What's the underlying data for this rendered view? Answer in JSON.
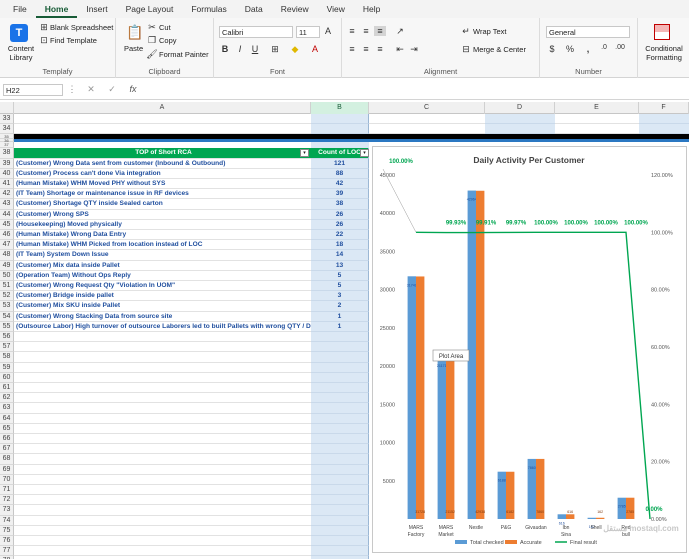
{
  "ribbon_tabs": [
    "File",
    "Home",
    "Insert",
    "Page Layout",
    "Formulas",
    "Data",
    "Review",
    "View",
    "Help"
  ],
  "active_tab": "Home",
  "templafy": {
    "content_library": "Content Library",
    "blank_spreadsheet": "Blank Spreadsheet",
    "find_template": "Find Template",
    "group": "Templafy"
  },
  "clipboard": {
    "paste": "Paste",
    "cut": "Cut",
    "copy": "Copy",
    "format_painter": "Format Painter",
    "group": "Clipboard"
  },
  "font": {
    "name": "Calibri",
    "size": "11",
    "group": "Font"
  },
  "alignment": {
    "wrap": "Wrap Text",
    "merge": "Merge & Center",
    "group": "Alignment"
  },
  "number": {
    "format": "General",
    "group": "Number"
  },
  "styles": {
    "conditional": "Conditional Formatting"
  },
  "name_box": "H22",
  "columns": [
    "A",
    "B",
    "C",
    "D",
    "E",
    "F"
  ],
  "table": {
    "header_a": "TOP of Short RCA",
    "header_b": "Count of LOC",
    "rows": [
      {
        "label": "(Customer) Wrong Data sent from customer (Inbound & Outbound)",
        "count": "121"
      },
      {
        "label": "(Customer) Process can't done Via integration",
        "count": "88"
      },
      {
        "label": "(Human Mistake) WHM Moved PHY without SYS",
        "count": "42"
      },
      {
        "label": "(IT Team) Shortage or maintenance issue in RF devices",
        "count": "39"
      },
      {
        "label": "(Customer) Shortage QTY inside Sealed carton",
        "count": "38"
      },
      {
        "label": "(Customer) Wrong SPS",
        "count": "26"
      },
      {
        "label": "(Housekeeping) Moved physically",
        "count": "26"
      },
      {
        "label": "(Human Mistake) Wrong Data Entry",
        "count": "22"
      },
      {
        "label": "(Human Mistake) WHM Picked from location instead of LOC",
        "count": "18"
      },
      {
        "label": "(IT Team) System Down Issue",
        "count": "14"
      },
      {
        "label": "(Customer) Mix data inside Pallet",
        "count": "13"
      },
      {
        "label": "(Operation Team) Without Ops Reply",
        "count": "5"
      },
      {
        "label": "(Customer) Wrong Request Qty \"Violation In UOM\"",
        "count": "5"
      },
      {
        "label": "(Customer) Bridge inside pallet",
        "count": "3"
      },
      {
        "label": "(Customer) Mix SKU inside Pallet",
        "count": "2"
      },
      {
        "label": "(Customer) Wrong Stacking Data from source site",
        "count": "1"
      },
      {
        "label": "(Outsource Labor) High turnover of outsource Laborers led to built Pallets with wrong QTY / Data",
        "count": "1"
      }
    ]
  },
  "tooltip": "Plot Area",
  "watermark": "مستقل mostaql.com",
  "chart_data": {
    "type": "bar",
    "title": "Daily Activity Per Customer",
    "categories": [
      "MARS Factory",
      "MARS Market",
      "Nestle",
      "P&G",
      "Givaudan",
      "Ibn Sina",
      "Shell",
      "Red bull"
    ],
    "series": [
      {
        "name": "Total checked",
        "values": [
          31749,
          21171,
          42964,
          6188,
          7860,
          616,
          162,
          2785
        ],
        "color": "#5b9bd5"
      },
      {
        "name": "Accurate",
        "values": [
          31728,
          21152,
          42938,
          6182,
          7860,
          616,
          162,
          2785
        ],
        "color": "#ed7d31"
      }
    ],
    "line": {
      "name": "Final result",
      "values": [
        100.0,
        99.93,
        99.91,
        99.97,
        100.0,
        100.0,
        100.0,
        100.0
      ],
      "color": "#00a651"
    },
    "extra_point": {
      "label": "0.00%",
      "value": 0
    },
    "line_labels": [
      "100.00%",
      "99.93%",
      "99.91%",
      "99.97%",
      "100.00%",
      "100.00%",
      "100.00%",
      "100.00%"
    ],
    "ylim": [
      0,
      45000
    ],
    "y_ticks": [
      5000,
      10000,
      15000,
      20000,
      25000,
      30000,
      35000,
      40000,
      45000
    ],
    "y2lim": [
      0,
      120
    ],
    "y2_ticks": [
      "0.00%",
      "20.00%",
      "40.00%",
      "60.00%",
      "80.00%",
      "100.00%",
      "120.00%"
    ],
    "legend": "bottom"
  }
}
